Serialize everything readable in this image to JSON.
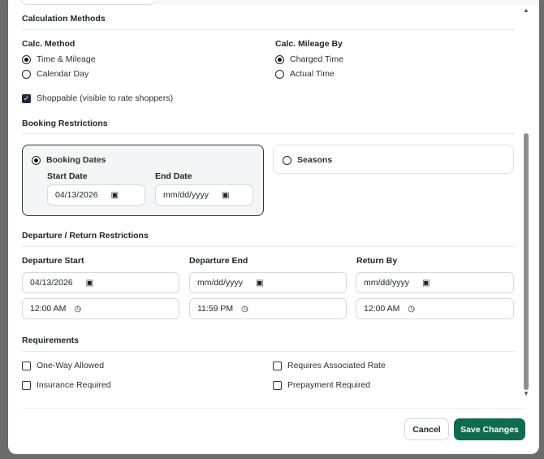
{
  "calc": {
    "section_title": "Calculation Methods",
    "method_label": "Calc. Method",
    "method_options": [
      "Time & Mileage",
      "Calendar Day"
    ],
    "mileage_label": "Calc. Mileage By",
    "mileage_options": [
      "Charged Time",
      "Actual Time"
    ],
    "shoppable_label": "Shoppable (visible to rate shoppers)"
  },
  "booking": {
    "section_title": "Booking Restrictions",
    "dates_option": "Booking Dates",
    "start_label": "Start Date",
    "start_value": "04/13/2026",
    "end_label": "End Date",
    "end_value": "mm/dd/yyyy",
    "seasons_option": "Seasons"
  },
  "departure": {
    "section_title": "Departure / Return Restrictions",
    "start_label": "Departure Start",
    "start_date": "04/13/2026",
    "start_time": "12:00 AM",
    "end_label": "Departure End",
    "end_date": "mm/dd/yyyy",
    "end_time": "11:59 PM",
    "return_label": "Return By",
    "return_date": "mm/dd/yyyy",
    "return_time": "12:00 AM"
  },
  "requirements": {
    "section_title": "Requirements",
    "one_way": "One-Way Allowed",
    "insurance": "Insurance Required",
    "assoc_rate": "Requires Associated Rate",
    "prepayment": "Prepayment Required"
  },
  "footer": {
    "cancel": "Cancel",
    "save": "Save Changes"
  },
  "icons": {
    "calendar": "calendar-icon",
    "clock": "clock-icon"
  },
  "colors": {
    "primary": "#0f6b4f"
  }
}
